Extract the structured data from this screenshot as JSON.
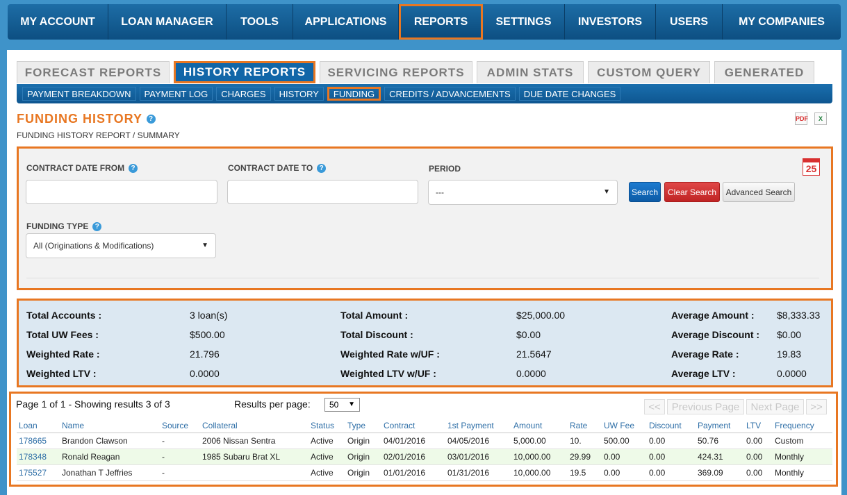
{
  "topnav": [
    "MY ACCOUNT",
    "LOAN MANAGER",
    "TOOLS",
    "APPLICATIONS",
    "REPORTS",
    "SETTINGS",
    "INVESTORS",
    "USERS",
    "MY COMPANIES"
  ],
  "tabs": [
    "FORECAST REPORTS",
    "HISTORY REPORTS",
    "SERVICING REPORTS",
    "ADMIN STATS",
    "CUSTOM QUERY",
    "GENERATED"
  ],
  "subnav": [
    "PAYMENT BREAKDOWN",
    "PAYMENT LOG",
    "CHARGES",
    "HISTORY",
    "FUNDING",
    "CREDITS / ADVANCEMENTS",
    "DUE DATE CHANGES"
  ],
  "page": {
    "title": "FUNDING HISTORY",
    "subtitle": "FUNDING HISTORY REPORT / SUMMARY",
    "help_glyph": "?",
    "pdf_glyph": "PDF",
    "xls_glyph": "X"
  },
  "search": {
    "contract_from_label": "CONTRACT DATE FROM",
    "contract_to_label": "CONTRACT DATE TO",
    "period_label": "PERIOD",
    "period_value": "---",
    "funding_type_label": "FUNDING TYPE",
    "funding_type_value": "All (Originations & Modifications)",
    "search_btn": "Search",
    "clear_btn": "Clear Search",
    "advanced_btn": "Advanced Search",
    "calendar_day": "25"
  },
  "summary": {
    "total_accounts_label": "Total Accounts :",
    "total_accounts": "3 loan(s)",
    "total_amount_label": "Total Amount :",
    "total_amount": "$25,000.00",
    "average_amount_label": "Average Amount :",
    "average_amount": "$8,333.33",
    "total_uw_fees_label": "Total UW Fees :",
    "total_uw_fees": "$500.00",
    "total_discount_label": "Total Discount :",
    "total_discount": "$0.00",
    "average_discount_label": "Average Discount :",
    "average_discount": "$0.00",
    "weighted_rate_label": "Weighted Rate :",
    "weighted_rate": "21.796",
    "weighted_rate_uf_label": "Weighted Rate w/UF :",
    "weighted_rate_uf": "21.5647",
    "average_rate_label": "Average Rate :",
    "average_rate": "19.83",
    "weighted_ltv_label": "Weighted LTV :",
    "weighted_ltv": "0.0000",
    "weighted_ltv_uf_label": "Weighted LTV w/UF :",
    "weighted_ltv_uf": "0.0000",
    "average_ltv_label": "Average LTV :",
    "average_ltv": "0.0000"
  },
  "results": {
    "page_info": "Page 1 of 1 - Showing results 3 of 3",
    "rpp_label": "Results per page:",
    "rpp_value": "50",
    "first": "<<",
    "prev": "Previous Page",
    "next": "Next Page",
    "last": ">>",
    "columns": [
      "Loan",
      "Name",
      "Source",
      "Collateral",
      "Status",
      "Type",
      "Contract",
      "1st Payment",
      "Amount",
      "Rate",
      "UW Fee",
      "Discount",
      "Payment",
      "LTV",
      "Frequency"
    ],
    "rows": [
      [
        "178665",
        "Brandon Clawson",
        "-",
        "2006 Nissan Sentra",
        "Active",
        "Origin",
        "04/01/2016",
        "04/05/2016",
        "5,000.00",
        "10.",
        "500.00",
        "0.00",
        "50.76",
        "0.00",
        "Custom"
      ],
      [
        "178348",
        "Ronald Reagan",
        "-",
        "1985 Subaru Brat XL",
        "Active",
        "Origin",
        "02/01/2016",
        "03/01/2016",
        "10,000.00",
        "29.99",
        "0.00",
        "0.00",
        "424.31",
        "0.00",
        "Monthly"
      ],
      [
        "175527",
        "Jonathan T Jeffries",
        "-",
        "",
        "Active",
        "Origin",
        "01/01/2016",
        "01/31/2016",
        "10,000.00",
        "19.5",
        "0.00",
        "0.00",
        "369.09",
        "0.00",
        "Monthly"
      ]
    ]
  }
}
